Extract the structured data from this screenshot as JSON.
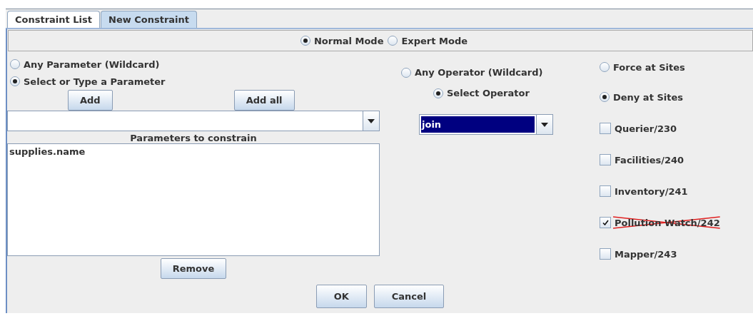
{
  "tabs": [
    {
      "label": "Constraint List",
      "selected": false
    },
    {
      "label": "New Constraint",
      "selected": true
    }
  ],
  "modes": [
    {
      "label": "Normal Mode",
      "selected": true
    },
    {
      "label": "Expert Mode",
      "selected": false
    }
  ],
  "parameter_options": [
    {
      "label": "Any Parameter (Wildcard)",
      "selected": false
    },
    {
      "label": "Select or Type a Parameter",
      "selected": true
    }
  ],
  "parameter_buttons": [
    "Add",
    "Add all"
  ],
  "parameters_label": "Parameters to constrain",
  "parameters": [
    "supplies.name"
  ],
  "remove_button": "Remove",
  "operator_options": [
    {
      "label": "Any Operator (Wildcard)",
      "selected": false
    },
    {
      "label": "Select Operator",
      "selected": true
    }
  ],
  "operator_combo": {
    "value": "join"
  },
  "site_modes": [
    {
      "label": "Force at Sites",
      "selected": false
    },
    {
      "label": "Deny at Sites",
      "selected": true
    }
  ],
  "sites": [
    {
      "label": "Querier/230",
      "checked": false
    },
    {
      "label": "Facilities/240",
      "checked": false
    },
    {
      "label": "Inventory/241",
      "checked": false
    },
    {
      "label": "Pollution Watch/242",
      "checked": true
    },
    {
      "label": "Mapper/243",
      "checked": false
    }
  ],
  "actions": [
    "OK",
    "Cancel"
  ]
}
